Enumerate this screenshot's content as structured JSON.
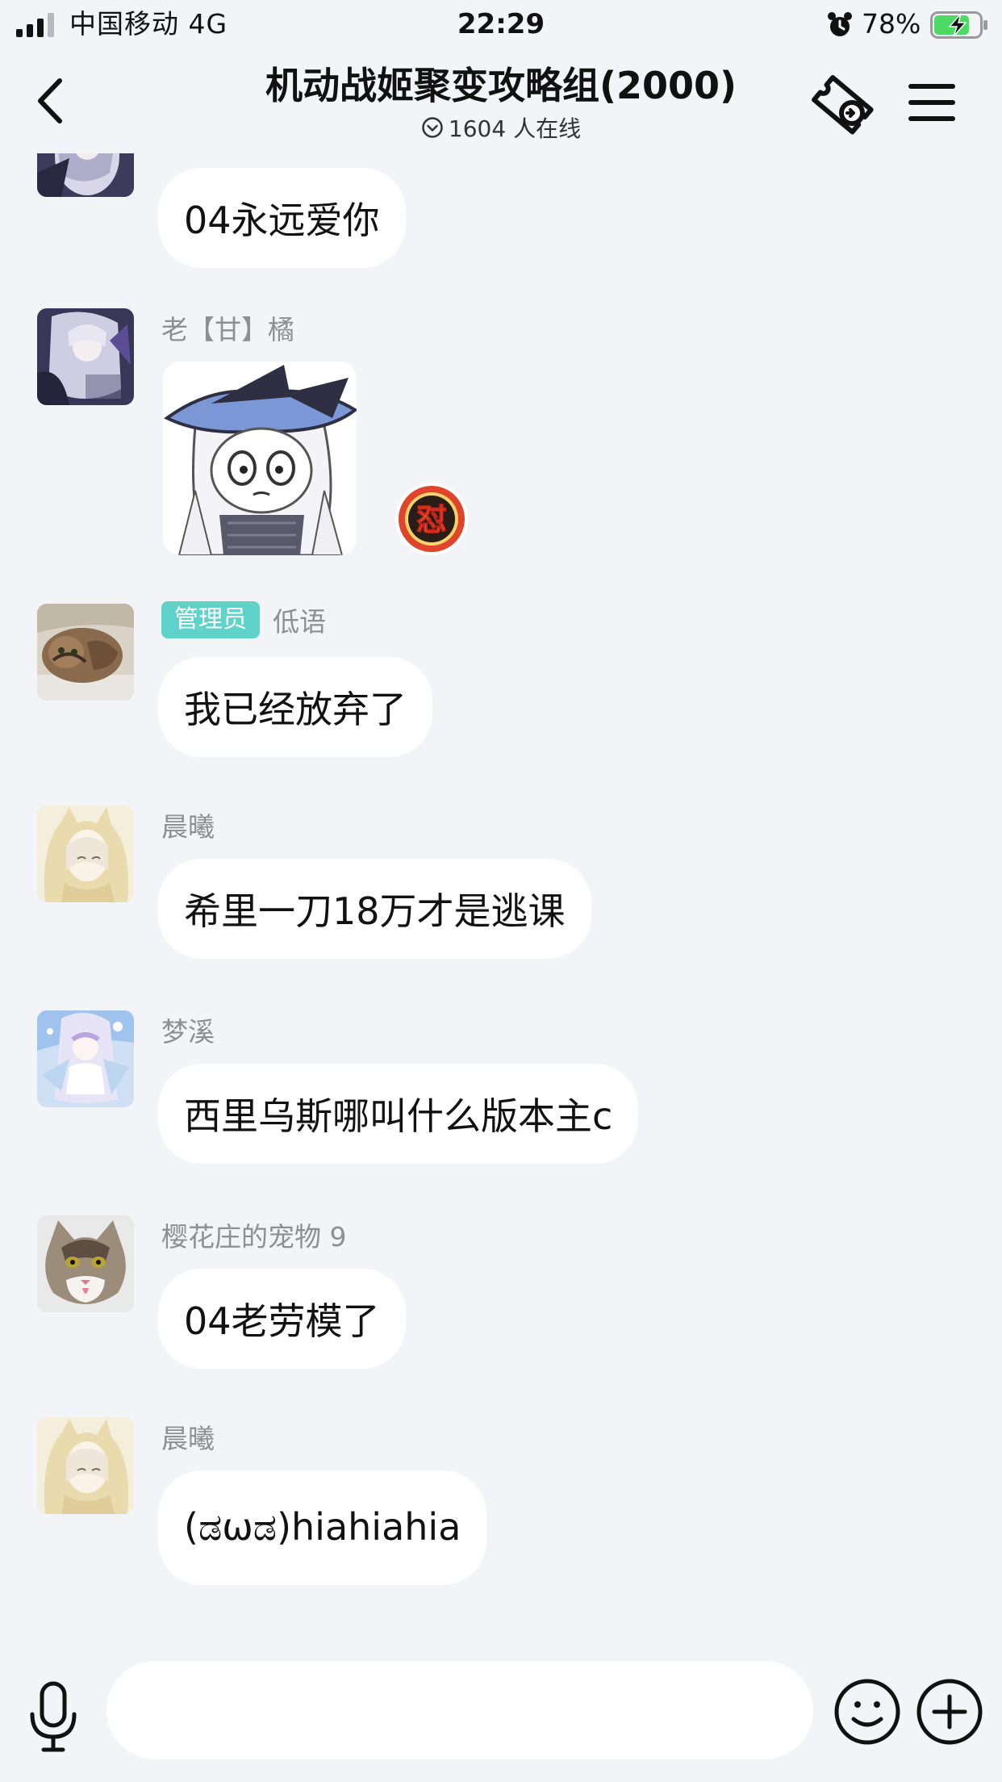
{
  "status_bar": {
    "carrier": "中国移动  4G",
    "time": "22:29",
    "battery_percent": "78%",
    "battery_level": 0.78,
    "charging": true,
    "icons": [
      "signal-bars-icon",
      "alarm-clock-icon",
      "battery-charging-icon"
    ]
  },
  "header": {
    "title": "机动战姬聚变攻略组(2000)",
    "online_count": "1604 人在线",
    "icons": [
      "back-arrow-icon",
      "chevron-down-circle-icon",
      "ticket-icon",
      "menu-icon"
    ]
  },
  "messages": [
    {
      "type": "text",
      "sender": "",
      "text": "04永远爱你"
    },
    {
      "type": "sticker",
      "sender": "老【甘】橘",
      "reaction_icon": "fight-badge-icon",
      "reaction_text": "怼"
    },
    {
      "type": "text",
      "sender": "低语",
      "badge": "管理员",
      "text": "我已经放弃了"
    },
    {
      "type": "text",
      "sender": "晨曦",
      "text": "希里一刀18万才是逃课"
    },
    {
      "type": "text",
      "sender": "梦溪",
      "text": "西里乌斯哪叫什么版本主c"
    },
    {
      "type": "text",
      "sender": "樱花庄的宠物 9",
      "text": "04老劳模了"
    },
    {
      "type": "text",
      "sender": "晨曦",
      "text": "(ಡωಡ)hiahiahia"
    }
  ],
  "input_bar": {
    "placeholder": "",
    "icons": [
      "microphone-icon",
      "smiley-icon",
      "plus-circle-icon"
    ]
  },
  "colors": {
    "background": "#f3f4f8",
    "bubble": "#ffffff",
    "admin_badge": "#5fd3c9",
    "sender_name": "#8e8e93",
    "battery_green": "#4cd964"
  }
}
